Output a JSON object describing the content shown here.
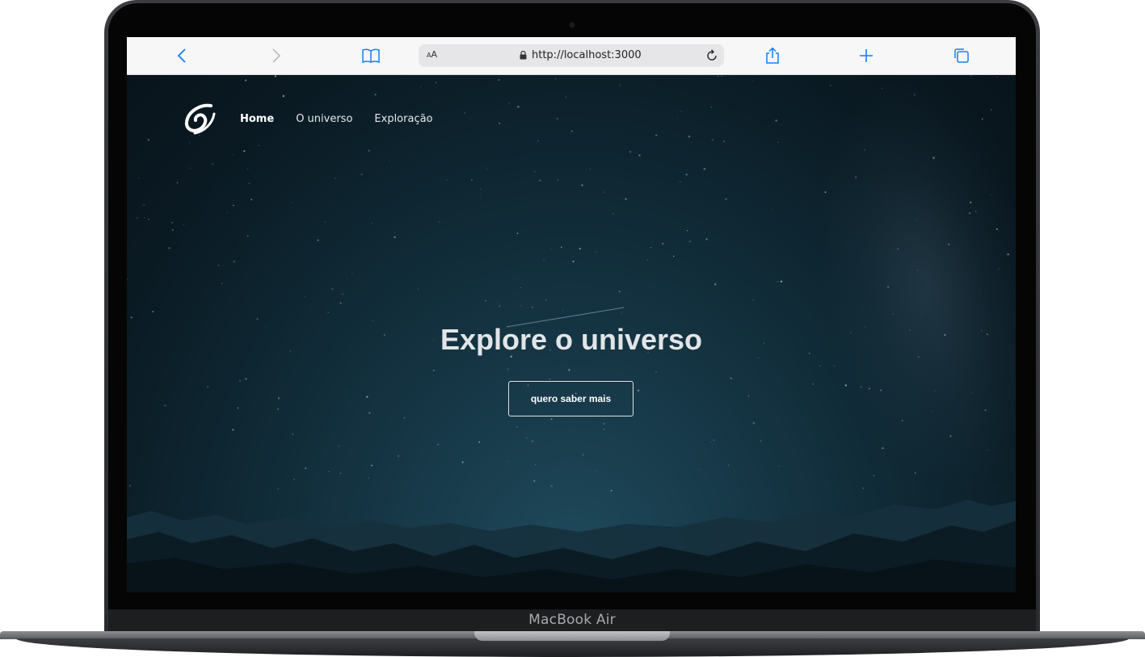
{
  "device": {
    "label": "MacBook Air"
  },
  "browser": {
    "text_size_label": "AA",
    "url": "http://localhost:3000",
    "icons": [
      "back-icon",
      "forward-icon",
      "bookmarks-icon",
      "lock-icon",
      "reload-icon",
      "share-icon",
      "new-tab-icon",
      "tabs-icon"
    ],
    "accent": "#147efb"
  },
  "site": {
    "nav": {
      "logo": "swirl-logo",
      "items": [
        {
          "label": "Home",
          "active": true
        },
        {
          "label": "O universo",
          "active": false
        },
        {
          "label": "Exploração",
          "active": false
        }
      ]
    },
    "hero": {
      "title": "Explore o universo",
      "button_label": "quero saber mais"
    }
  }
}
